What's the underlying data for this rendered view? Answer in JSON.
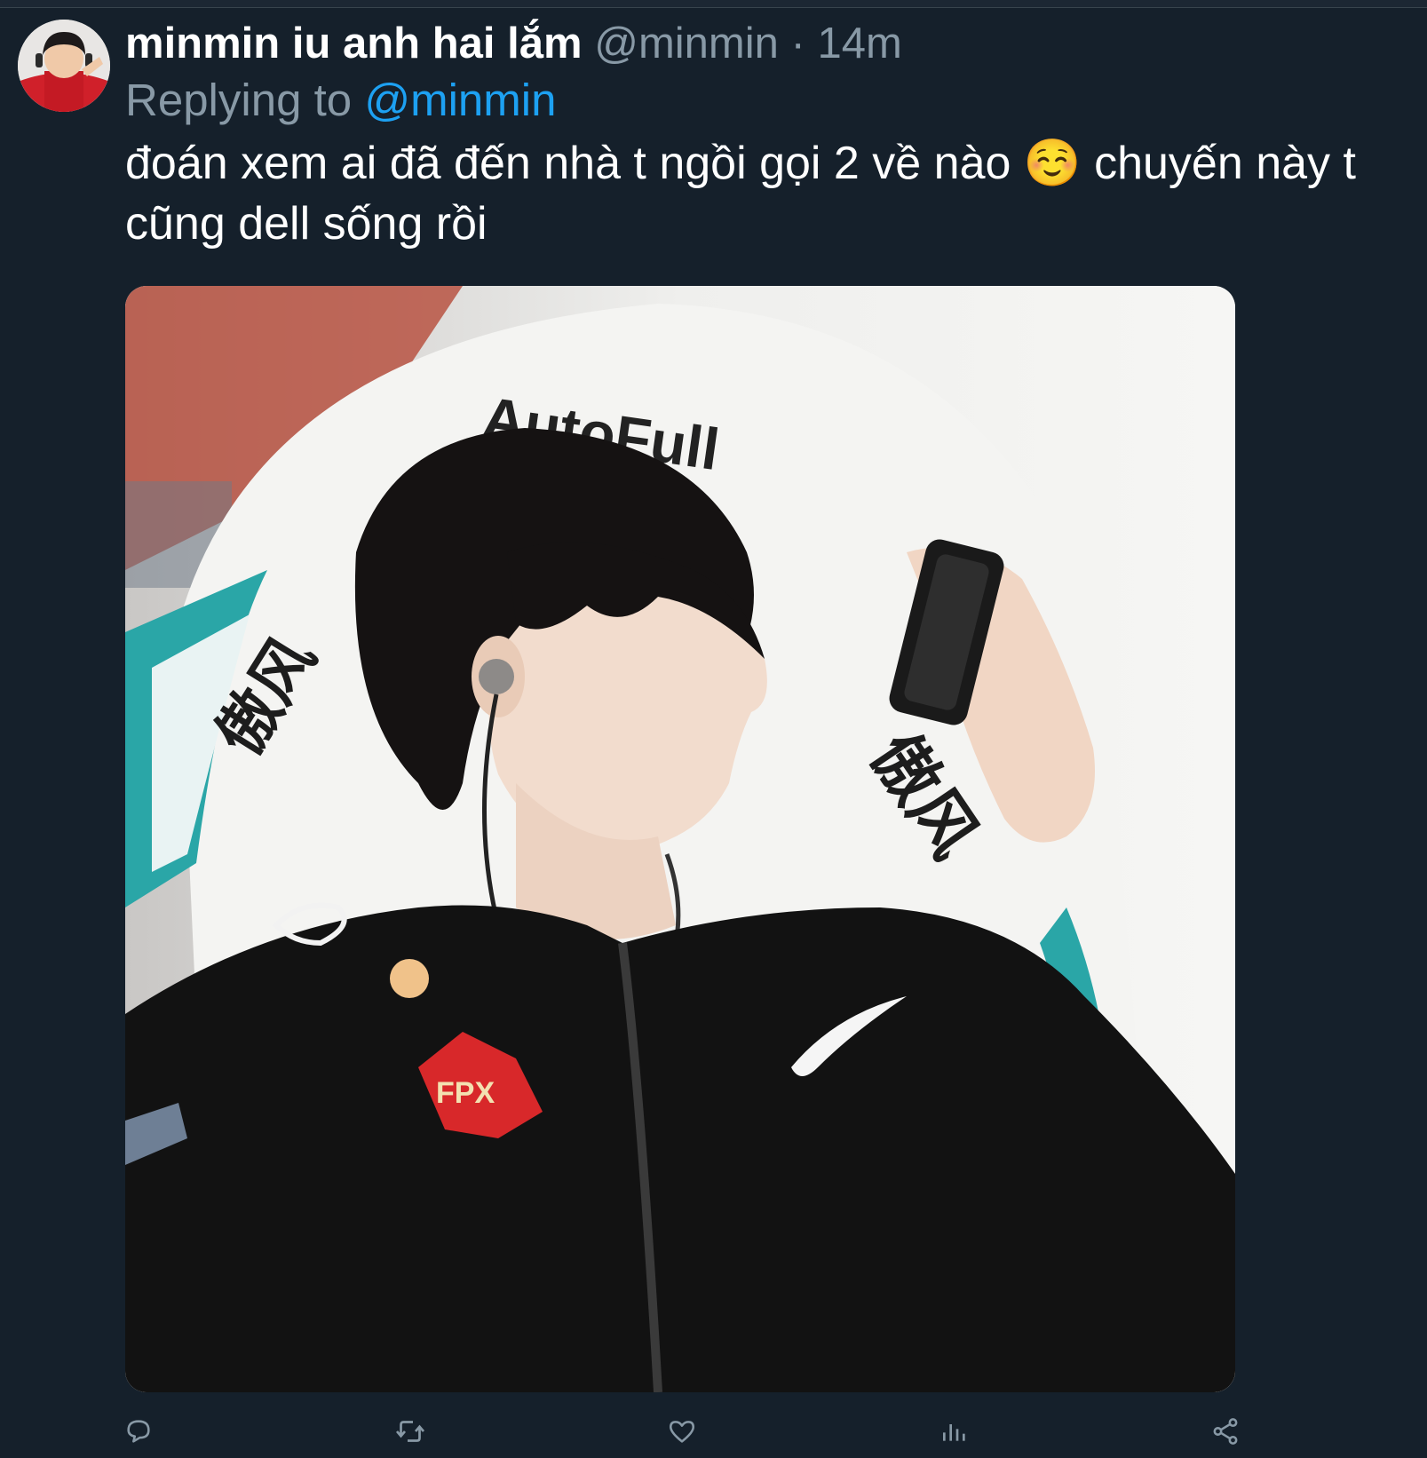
{
  "tweet": {
    "display_name": "minmin iu anh hai lắm",
    "handle": "@minmin",
    "separator": "·",
    "time": "14m",
    "replying_prefix": "Replying to",
    "replying_handle": "@minmin",
    "text_part1": "đoán xem ai đã đến nhà t ngồi gọi 2 về nào",
    "emoji": "☺️",
    "text_part2": "chuyến này t cũng dell sống rồi"
  },
  "media": {
    "chair_brand": "AutoFull",
    "chair_chinese_left": "傲风",
    "chair_chinese_right": "傲风",
    "team_patch": "FPX"
  },
  "actions": [
    {
      "name": "reply-button",
      "icon": "reply-icon"
    },
    {
      "name": "retweet-button",
      "icon": "retweet-icon"
    },
    {
      "name": "like-button",
      "icon": "heart-icon"
    },
    {
      "name": "analytics-button",
      "icon": "analytics-icon"
    },
    {
      "name": "share-button",
      "icon": "share-icon"
    }
  ],
  "colors": {
    "background": "#15202b",
    "secondary_text": "#8899a6",
    "link": "#1da1f2"
  }
}
